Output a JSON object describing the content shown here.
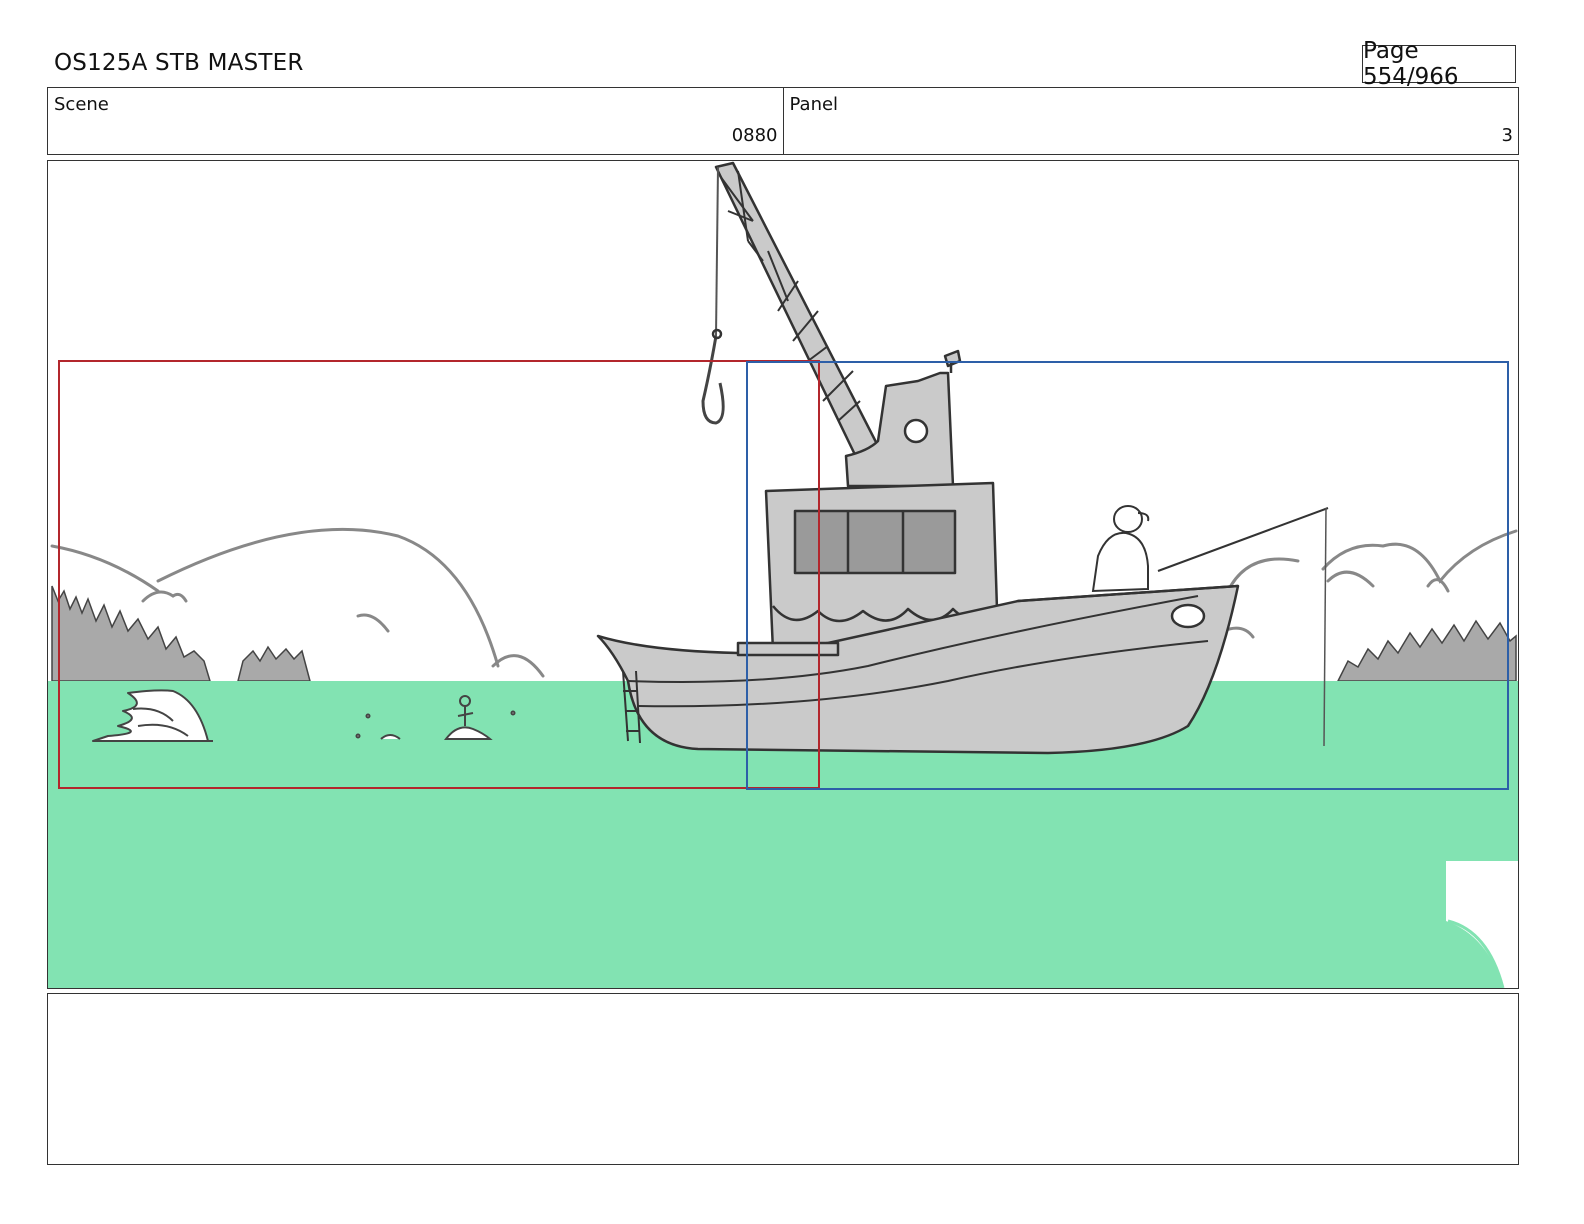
{
  "header": {
    "title": "OS125A  STB MASTER",
    "page_label": "Page 554/966"
  },
  "scene": {
    "label": "Scene",
    "value": "0880"
  },
  "panel": {
    "label": "Panel",
    "value": "3"
  },
  "colors": {
    "water": "#82e3b2",
    "sketch_fill": "#cacaca",
    "tree_fill": "#a9a9a9",
    "line": "#333333",
    "frame_red": "#b3262c",
    "frame_blue": "#2d5fa8"
  }
}
